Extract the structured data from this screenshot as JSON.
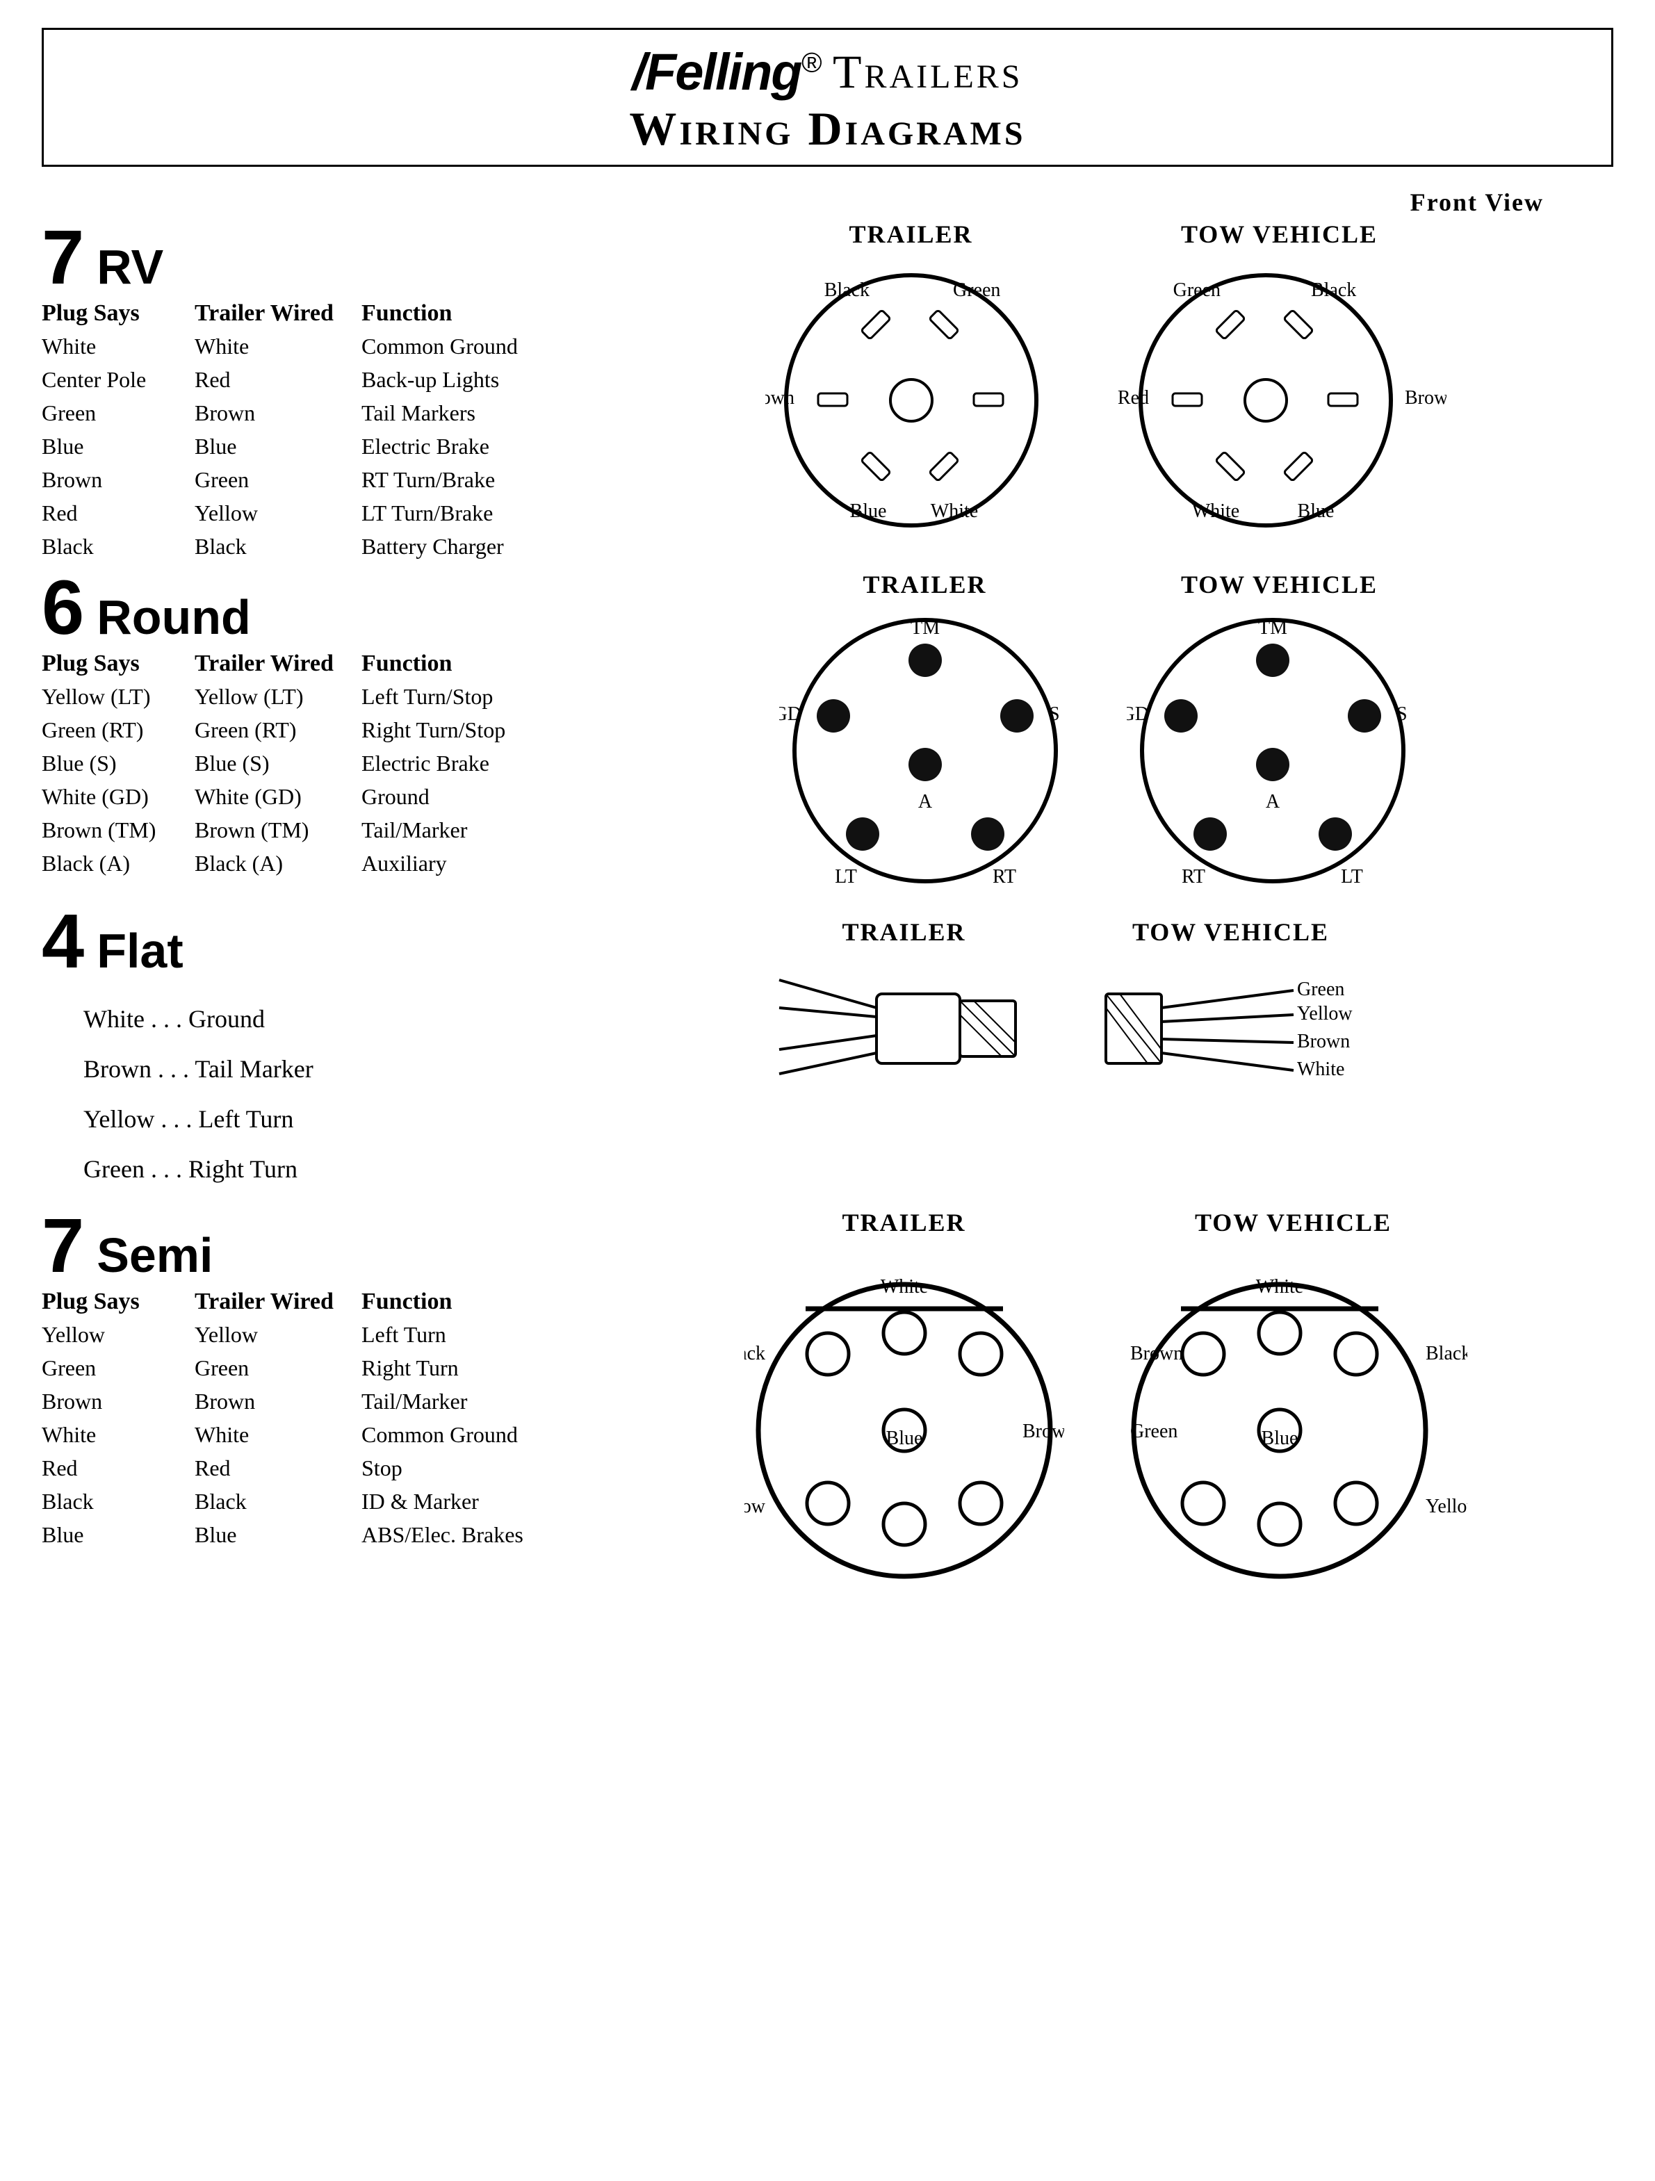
{
  "header": {
    "brand": "Felling",
    "brand_suffix": ".",
    "line1_right": "Trailers",
    "line2": "Wiring Diagrams"
  },
  "front_view_label": "Front View",
  "sections": {
    "rv7": {
      "number": "7",
      "name": "RV",
      "col_plug": "Plug Says",
      "col_wired": "Trailer Wired",
      "col_func": "Function",
      "rows": [
        {
          "plug": "White",
          "wired": "White",
          "func": "Common Ground"
        },
        {
          "plug": "Center Pole",
          "wired": "Red",
          "func": "Back-up Lights"
        },
        {
          "plug": "Green",
          "wired": "Brown",
          "func": "Tail Markers"
        },
        {
          "plug": "Blue",
          "wired": "Blue",
          "func": "Electric Brake"
        },
        {
          "plug": "Brown",
          "wired": "Green",
          "func": "RT Turn/Brake"
        },
        {
          "plug": "Red",
          "wired": "Yellow",
          "func": "LT Turn/Brake"
        },
        {
          "plug": "Black",
          "wired": "Black",
          "func": "Battery Charger"
        }
      ],
      "trailer_label": "TRAILER",
      "tow_label": "TOW VEHICLE",
      "trailer_labels": {
        "top_left": "Black",
        "top_right": "Green",
        "left": "Brown",
        "bottom_left": "Blue",
        "bottom_right": "White"
      },
      "tow_labels": {
        "top_left": "Green",
        "top_right": "Black",
        "left": "Red",
        "bottom_left": "White",
        "bottom_right": "Blue",
        "right": "Brown"
      }
    },
    "round6": {
      "number": "6",
      "name": "Round",
      "col_plug": "Plug Says",
      "col_wired": "Trailer Wired",
      "col_func": "Function",
      "rows": [
        {
          "plug": "Yellow (LT)",
          "wired": "Yellow (LT)",
          "func": "Left Turn/Stop"
        },
        {
          "plug": "Green (RT)",
          "wired": "Green (RT)",
          "func": "Right Turn/Stop"
        },
        {
          "plug": "Blue (S)",
          "wired": "Blue (S)",
          "func": "Electric Brake"
        },
        {
          "plug": "White (GD)",
          "wired": "White (GD)",
          "func": "Ground"
        },
        {
          "plug": "Brown (TM)",
          "wired": "Brown (TM)",
          "func": "Tail/Marker"
        },
        {
          "plug": "Black (A)",
          "wired": "Black (A)",
          "func": "Auxiliary"
        }
      ],
      "trailer_label": "TRAILER",
      "tow_label": "TOW VEHICLE",
      "trailer_pin_labels": {
        "top": "TM",
        "left": "GD",
        "right": "S",
        "bottom_left": "LT",
        "bottom_right": "RT",
        "center": "A"
      },
      "tow_pin_labels": {
        "top": "TM",
        "left": "GD",
        "right": "S",
        "bottom_left": "RT",
        "bottom_right": "LT",
        "center": "A"
      }
    },
    "flat4": {
      "number": "4",
      "name": "Flat",
      "trailer_label": "TRAILER",
      "tow_label": "TOW VEHICLE",
      "lines": [
        "White . . . Ground",
        "Brown . . . Tail Marker",
        "Yellow . . . Left Turn",
        "Green . . . Right Turn"
      ],
      "tow_wire_labels": [
        "Green",
        "Yellow",
        "Brown",
        "White"
      ]
    },
    "semi7": {
      "number": "7",
      "name": "Semi",
      "col_plug": "Plug Says",
      "col_wired": "Trailer Wired",
      "col_func": "Function",
      "rows": [
        {
          "plug": "Yellow",
          "wired": "Yellow",
          "func": "Left Turn"
        },
        {
          "plug": "Green",
          "wired": "Green",
          "func": "Right Turn"
        },
        {
          "plug": "Brown",
          "wired": "Brown",
          "func": "Tail/Marker"
        },
        {
          "plug": "White",
          "wired": "White",
          "func": "Common Ground"
        },
        {
          "plug": "Red",
          "wired": "Red",
          "func": "Stop"
        },
        {
          "plug": "Black",
          "wired": "Black",
          "func": "ID  & Marker"
        },
        {
          "plug": "Blue",
          "wired": "Blue",
          "func": "ABS/Elec. Brakes"
        }
      ],
      "trailer_label": "TRAILER",
      "tow_label": "TOW VEHICLE",
      "trailer_pin_labels": {
        "top": "White",
        "left": "Black",
        "bottom": "Yellow",
        "center": "Blue",
        "right_mid": "Brown"
      },
      "tow_pin_labels": {
        "top": "White",
        "right": "Black",
        "bottom": "Yellow",
        "center": "Blue",
        "left_mid": "Brown",
        "left": "Green"
      }
    }
  }
}
